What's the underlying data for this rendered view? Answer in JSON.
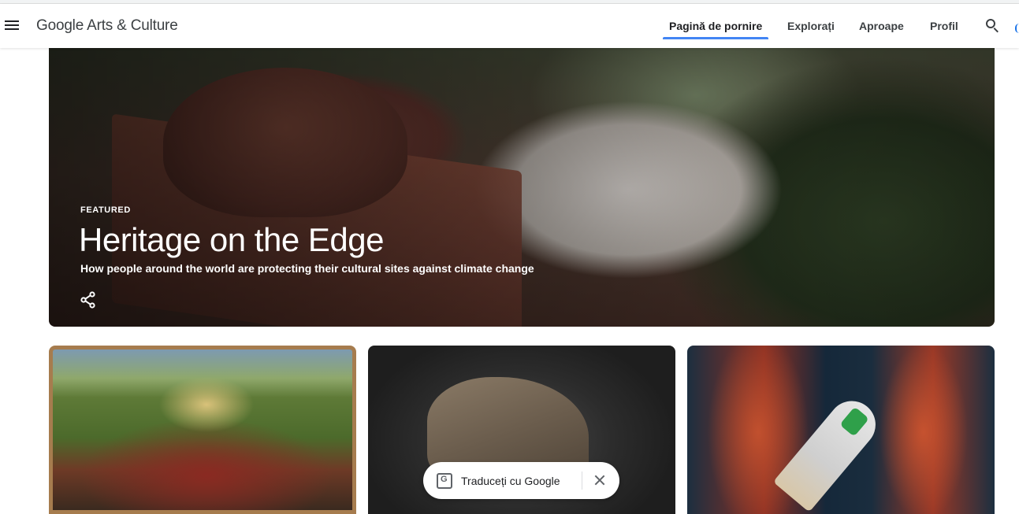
{
  "header": {
    "menu_icon": "hamburger-menu-icon",
    "logo_text": "Google Arts & Culture",
    "nav": [
      {
        "label": "Pagină de pornire",
        "active": true
      },
      {
        "label": "Explorați",
        "active": false
      },
      {
        "label": "Aproape",
        "active": false
      },
      {
        "label": "Profil",
        "active": false
      }
    ],
    "search_icon": "search-icon",
    "accent_color": "#4285f4"
  },
  "hero": {
    "label": "FEATURED",
    "title": "Heritage on the Edge",
    "subtitle": "How people around the world are protecting their cultural sites against climate change",
    "share_icon": "share-icon"
  },
  "translate_bar": {
    "icon": "google-translate-icon",
    "label": "Traduceți cu Google",
    "close_icon": "close-icon"
  }
}
